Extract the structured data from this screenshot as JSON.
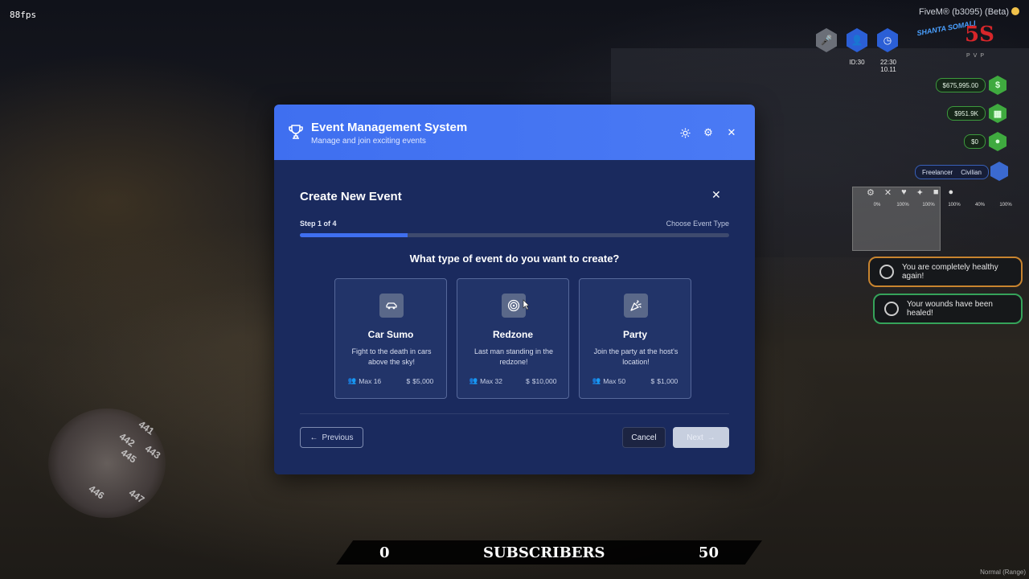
{
  "game_hud": {
    "fps": "88fps",
    "build": "FiveM® (b3095) (Beta)",
    "top_icons": [
      {
        "icon": "microphone-icon"
      },
      {
        "icon": "user-icon",
        "label": "ID:30"
      },
      {
        "icon": "clock-icon",
        "label": "22:30\n10.11"
      }
    ],
    "server_logo_1": "SHANTA SOMALI",
    "server_logo_2": "5S",
    "server_logo_2_sub": "PVP",
    "money": [
      {
        "value": "$675,995.00",
        "icon": "dollar-icon"
      },
      {
        "value": "$951.9K",
        "icon": "bank-icon"
      },
      {
        "value": "$0",
        "icon": "wallet-icon"
      }
    ],
    "job": {
      "company": "Freelancer",
      "grade": "Civilian"
    },
    "status_values": [
      "0%",
      "100%",
      "100%",
      "100%",
      "40%",
      "100%"
    ],
    "notifications": [
      {
        "text": "You are completely healthy again!",
        "color": "#c8842f"
      },
      {
        "text": "Your wounds have been healed!",
        "color": "#35a35a"
      }
    ],
    "minimap_labels": [
      "445",
      "447",
      "446",
      "442",
      "441",
      "443"
    ],
    "subscribers": {
      "left": "0",
      "label": "SUBSCRIBERS",
      "right": "50"
    },
    "mode": "Normal (Range)"
  },
  "modal": {
    "title": "Event Management System",
    "subtitle": "Manage and join exciting events",
    "accent": "#3f6ff0",
    "create": {
      "title": "Create New Event",
      "step_label": "Step 1 of 4",
      "step_name": "Choose Event Type",
      "progress": 0.25,
      "question": "What type of event do you want to create?",
      "event_types": [
        {
          "name": "Car Sumo",
          "icon": "car-icon",
          "desc": "Fight to the death in cars above the sky!",
          "max": "Max 16",
          "price": "$5,000"
        },
        {
          "name": "Redzone",
          "icon": "target-icon",
          "desc": "Last man standing in the redzone!",
          "max": "Max 32",
          "price": "$10,000"
        },
        {
          "name": "Party",
          "icon": "party-popper-icon",
          "desc": "Join the party at the host's location!",
          "max": "Max 50",
          "price": "$1,000"
        }
      ],
      "buttons": {
        "previous": "Previous",
        "cancel": "Cancel",
        "next": "Next"
      }
    }
  }
}
